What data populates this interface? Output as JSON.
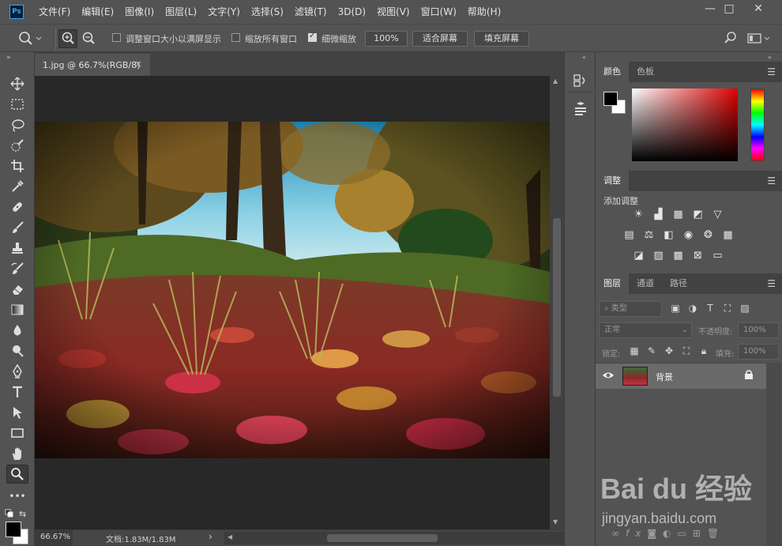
{
  "app": {
    "logo": "Ps"
  },
  "menu": [
    "文件(F)",
    "编辑(E)",
    "图像(I)",
    "图层(L)",
    "文字(Y)",
    "选择(S)",
    "滤镜(T)",
    "3D(D)",
    "视图(V)",
    "窗口(W)",
    "帮助(H)"
  ],
  "window_controls": {
    "minimize": "—",
    "maximize": "□",
    "close": "✕"
  },
  "options": {
    "resize_windows_label": "调整窗口大小以满屏显示",
    "zoom_all_label": "缩放所有窗口",
    "scrubby_zoom_label": "细微缩放",
    "zoom_value": "100%",
    "fit_screen": "适合屏幕",
    "fill_screen": "填充屏幕"
  },
  "document": {
    "tab_title": "1.jpg @ 66.7%(RGB/8)",
    "tab_close": "×"
  },
  "status": {
    "zoom": "66.67%",
    "doc_size": "文档:1.83M/1.83M",
    "arrow": "›"
  },
  "color_panel": {
    "tabs": [
      "颜色",
      "色板"
    ]
  },
  "adjust_panel": {
    "tab": "调整",
    "add_label": "添加调整"
  },
  "layers_panel": {
    "tabs": [
      "图层",
      "通道",
      "路径"
    ],
    "filter_placeholder": "类型",
    "blend_mode": "正常",
    "opacity_label": "不透明度:",
    "opacity_value": "100%",
    "lock_label": "锁定:",
    "fill_label": "填充:",
    "fill_value": "100%",
    "layers": [
      {
        "name": "背景",
        "visible": true,
        "locked": true
      }
    ]
  },
  "watermark": {
    "brand": "Bai du 经验",
    "url": "jingyan.baidu.com"
  },
  "colors": {
    "accent": "#31a8ff",
    "panel_bg": "#535353",
    "canvas_bg": "#282828"
  },
  "icons": [
    "zoom-icon",
    "move-icon",
    "marquee-icon",
    "lasso-icon",
    "quick-select-icon",
    "crop-icon",
    "eyedropper-icon",
    "healing-icon",
    "brush-icon",
    "stamp-icon",
    "history-brush-icon",
    "eraser-icon",
    "gradient-icon",
    "blur-icon",
    "dodge-icon",
    "pen-icon",
    "type-icon",
    "path-select-icon",
    "rectangle-icon",
    "hand-icon",
    "more-icon",
    "eye-icon",
    "lock-icon"
  ]
}
